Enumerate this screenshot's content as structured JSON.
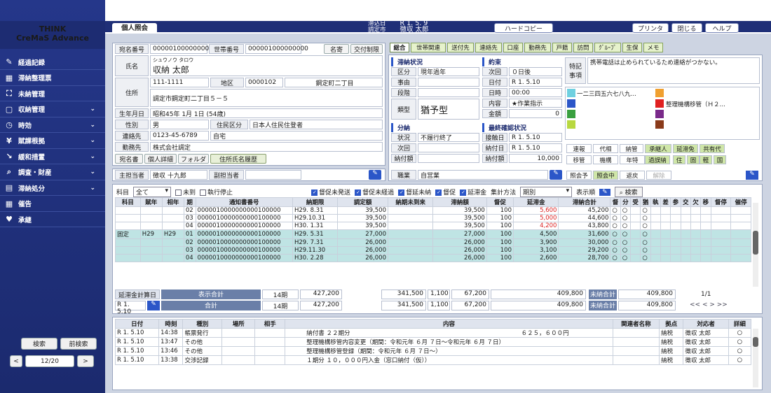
{
  "brand": {
    "line1": "THINK",
    "line2": "CreMaS Advance"
  },
  "nav": [
    {
      "label": "経過記録",
      "icon": "pencil-icon",
      "chevron": false
    },
    {
      "label": "滞納整理票",
      "icon": "stamp-icon",
      "chevron": false
    },
    {
      "label": "未納管理",
      "icon": "chart-icon",
      "chevron": false
    },
    {
      "label": "収納管理",
      "icon": "box-icon",
      "chevron": true
    },
    {
      "label": "時効",
      "icon": "clock-icon",
      "chevron": true
    },
    {
      "label": "賦課根拠",
      "icon": "yen-icon",
      "chevron": true
    },
    {
      "label": "緩和措置",
      "icon": "trend-down-icon",
      "chevron": true
    },
    {
      "label": "調査・財産",
      "icon": "search-icon",
      "chevron": true
    },
    {
      "label": "滞納処分",
      "icon": "document-icon",
      "chevron": true
    },
    {
      "label": "催告",
      "icon": "stamp-icon",
      "chevron": false
    },
    {
      "label": "承継",
      "icon": "heart-icon",
      "chevron": false
    }
  ],
  "sidebar_buttons": {
    "search": "検索",
    "prev_search": "前検索",
    "page": "12/20",
    "prev": "<",
    "next": ">"
  },
  "tab_main": "個人照会",
  "top_info": {
    "l1": "滞込日",
    "l2": "調定市",
    "v1": "R 1. 5. 9",
    "v2": "徴収 太郎"
  },
  "top_buttons": {
    "hardcopy": "ハードコピー",
    "printer": "プリンタ",
    "close": "閉じる",
    "help": "ヘルプ"
  },
  "person": {
    "atena_label": "宛名番号",
    "atena": "000001000000001",
    "setai_label": "世帯番号",
    "setai": "000001000000000",
    "meiki_btn": "名寄",
    "koufu_btn": "交付制限",
    "name_label": "氏名",
    "kana": "シュウノウ タロウ",
    "name": "収納 太郎",
    "address_label": "住所",
    "zip": "111-1111",
    "area_label": "地区",
    "area_code": "0000102",
    "area": "鋼定町二丁目",
    "address": "調定市鋼定町二丁目５－５",
    "birth_label": "生年月日",
    "birth": "昭和45年 1月 1日 (54歳)",
    "sex_label": "性別",
    "sex": "男",
    "residence_label": "住民区分",
    "residence": "日本人住民住登者",
    "contact_label": "連絡先",
    "phone": "0123-45-6789",
    "phone_type": "自宅",
    "work_label": "勤務先",
    "work": "株式会社調定",
    "btns": [
      "宛名書",
      "個人詳細",
      "フォルダ",
      "住所氏名履歴"
    ],
    "tantou_label": "主担当者",
    "tantou": "徴収 十九郎",
    "sub_label": "副担当者",
    "sub": ""
  },
  "tabs": [
    "総合",
    "世帯関連",
    "送付先",
    "連絡先",
    "口座",
    "勤務先",
    "戸籍",
    "訪問",
    "ｸﾞﾙｰﾌﾟ",
    "生保",
    "メモ"
  ],
  "delinq": {
    "title": "滞納状況",
    "kubun_label": "区分",
    "kubun": "現年過年",
    "jiyu_label": "事由",
    "jiyu": "",
    "dankai_label": "段階",
    "dankai": "",
    "ruikei_label": "類型",
    "ruikei": "猶予型",
    "shokuyo_label": "職業",
    "shokuyo": "自営業"
  },
  "bunno": {
    "title": "分納",
    "status_label": "状況",
    "status": "不履行終了",
    "next_label": "次回",
    "next": "",
    "amt_label": "納付額",
    "amt": ""
  },
  "yakusoku": {
    "title": "約束",
    "next_label": "次回",
    "next": "０日後",
    "date_label": "日付",
    "date": "R 1. 5.10",
    "time_label": "日時",
    "time": "00:00",
    "content_label": "内容",
    "content": "★作業指示",
    "amt_label": "金額",
    "amt": "0"
  },
  "kakunin": {
    "title": "最終確認状況",
    "contact_label": "接触日",
    "contact": "R 1. 5.10",
    "paid_label": "納付日",
    "paid": "R 1. 5.10",
    "amt_label": "納付額",
    "amt": "10,000"
  },
  "tokki": {
    "label1": "特記",
    "label2": "事項",
    "text": "携帯電話は止められているため連絡がつかない。"
  },
  "colors": {
    "cyan": "#6fd0e0",
    "orange": "#f0a030",
    "blue1": "#2b56c8",
    "red": "#e02020",
    "green": "#3aa040",
    "purple": "#7a2a8a",
    "lime": "#b8d840",
    "brown": "#8a3a1a"
  },
  "color_labels": {
    "cyan": "一二三四五六七八九…",
    "red": "整理機構移管（Ｈ２…"
  },
  "right_flags": [
    "連報",
    "代相",
    "納管",
    "承継人",
    "延滞免",
    "共有代",
    "移管",
    "機構",
    "年特",
    "過誤納",
    "住",
    "固",
    "軽",
    "国"
  ],
  "right_bottom": [
    "照会予",
    "照会中",
    "返戻",
    "解除"
  ],
  "filter": {
    "kamoku_label": "科目",
    "kamoku": "全て",
    "chk_minou": "未到",
    "chk_shikko": "執行停止",
    "chk1": "督促未発送",
    "chk2": "督促未経過",
    "chk3": "督延未納",
    "chk4": "督促",
    "chk5": "延滞金",
    "agg_label": "集計方法",
    "agg": "期別",
    "disp": "表示順",
    "search": "検索"
  },
  "grid_headers": [
    "科目",
    "賦年",
    "相年",
    "期",
    "通知書番号",
    "納期限",
    "調定額",
    "納期未到来",
    "滞納額",
    "督促",
    "延滞金",
    "滞納合計",
    "督",
    "分",
    "受",
    "猶",
    "執",
    "差",
    "参",
    "交",
    "欠",
    "移",
    "督停",
    "催停"
  ],
  "grid_rows": [
    {
      "teal": false,
      "kamoku": "",
      "fnen": "",
      "snen": "",
      "ki": "02",
      "no": "0000010000000000100000",
      "limit": "H29. 8.31",
      "chotei": "39,500",
      "mitou": "",
      "tainou": "39,500",
      "toku": "100",
      "entai": "5,600",
      "red": true,
      "total": "45,200",
      "c1": "○",
      "c2": "○",
      "c3": "",
      "c4": "○"
    },
    {
      "teal": false,
      "kamoku": "",
      "fnen": "",
      "snen": "",
      "ki": "03",
      "no": "0000010000000000100000",
      "limit": "H29.10.31",
      "chotei": "39,500",
      "mitou": "",
      "tainou": "39,500",
      "toku": "100",
      "entai": "5,000",
      "red": true,
      "total": "44,600",
      "c1": "○",
      "c2": "○",
      "c3": "",
      "c4": "○"
    },
    {
      "teal": false,
      "kamoku": "",
      "fnen": "",
      "snen": "",
      "ki": "04",
      "no": "0000010000000000100000",
      "limit": "H30. 1.31",
      "chotei": "39,500",
      "mitou": "",
      "tainou": "39,500",
      "toku": "100",
      "entai": "4,200",
      "red": true,
      "total": "43,800",
      "c1": "○",
      "c2": "○",
      "c3": "",
      "c4": "○"
    },
    {
      "teal": true,
      "kamoku": "固定",
      "fnen": "H29",
      "snen": "H29",
      "ki": "01",
      "no": "0000010000000000100000",
      "limit": "H29. 5.31",
      "chotei": "27,000",
      "mitou": "",
      "tainou": "27,000",
      "toku": "100",
      "entai": "4,500",
      "red": false,
      "total": "31,600",
      "c1": "○",
      "c2": "○",
      "c3": "",
      "c4": "○"
    },
    {
      "teal": true,
      "kamoku": "",
      "fnen": "",
      "snen": "",
      "ki": "02",
      "no": "0000010000000000100000",
      "limit": "H29. 7.31",
      "chotei": "26,000",
      "mitou": "",
      "tainou": "26,000",
      "toku": "100",
      "entai": "3,900",
      "red": false,
      "total": "30,000",
      "c1": "○",
      "c2": "○",
      "c3": "",
      "c4": "○"
    },
    {
      "teal": true,
      "kamoku": "",
      "fnen": "",
      "snen": "",
      "ki": "03",
      "no": "0000010000000000100000",
      "limit": "H29.11.30",
      "chotei": "26,000",
      "mitou": "",
      "tainou": "26,000",
      "toku": "100",
      "entai": "3,100",
      "red": false,
      "total": "29,200",
      "c1": "○",
      "c2": "○",
      "c3": "",
      "c4": "○"
    },
    {
      "teal": true,
      "kamoku": "",
      "fnen": "",
      "snen": "",
      "ki": "04",
      "no": "0000010000000000100000",
      "limit": "H30. 2.28",
      "chotei": "26,000",
      "mitou": "",
      "tainou": "26,000",
      "toku": "100",
      "entai": "2,600",
      "red": false,
      "total": "28,700",
      "c1": "○",
      "c2": "○",
      "c3": "",
      "c4": "○"
    }
  ],
  "totals": {
    "calc_label": "延滞金計算日",
    "calc_date": "R 1. 5.10",
    "disp_label": "表示合計",
    "sum_label": "合計",
    "disp": {
      "ki": "14期",
      "chotei": "427,200",
      "tainou": "341,500",
      "toku": "1,100",
      "entai": "67,200",
      "total": "409,800"
    },
    "sum": {
      "ki": "14期",
      "chotei": "427,200",
      "tainou": "341,500",
      "toku": "1,100",
      "entai": "67,200",
      "total": "409,800"
    },
    "minou_label": "未納合計",
    "minou": "409,800",
    "page": "1/1",
    "pager": "<< < > >>"
  },
  "hist_headers": [
    "日付",
    "時刻",
    "種別",
    "場所",
    "相手",
    "内容",
    "関連者名称",
    "拠点",
    "対応者",
    "詳細"
  ],
  "hist_rows": [
    {
      "date": "R 1. 5.10",
      "time": "14:38",
      "type": "帳票発行",
      "place": "",
      "aite": "",
      "content": "納付書 ２２期分",
      "amount": "６２５，６００円",
      "kanren": "",
      "kyoten": "納税",
      "taiou": "徴収 太郎",
      "det": "○"
    },
    {
      "date": "R 1. 5.10",
      "time": "13:47",
      "type": "その他",
      "place": "",
      "aite": "",
      "content": "整理機構移管内容変更（期間：令和元年 ６月 ７日～令和元年 ６月 ７日）",
      "amount": "",
      "kanren": "",
      "kyoten": "納税",
      "taiou": "徴収 太郎",
      "det": "○"
    },
    {
      "date": "R 1. 5.10",
      "time": "13:46",
      "type": "その他",
      "place": "",
      "aite": "",
      "content": "整理機構移管登録（期間：令和元年 ６月 ７日～）",
      "amount": "",
      "kanren": "",
      "kyoten": "納税",
      "taiou": "徴収 太郎",
      "det": "○"
    },
    {
      "date": "R 1. 5.10",
      "time": "13:38",
      "type": "交渉記録",
      "place": "",
      "aite": "",
      "content": "１期分 １０，０００円入金（窓口納付（仮））",
      "amount": "",
      "kanren": "",
      "kyoten": "納税",
      "taiou": "徴収 太郎",
      "det": "○"
    }
  ]
}
